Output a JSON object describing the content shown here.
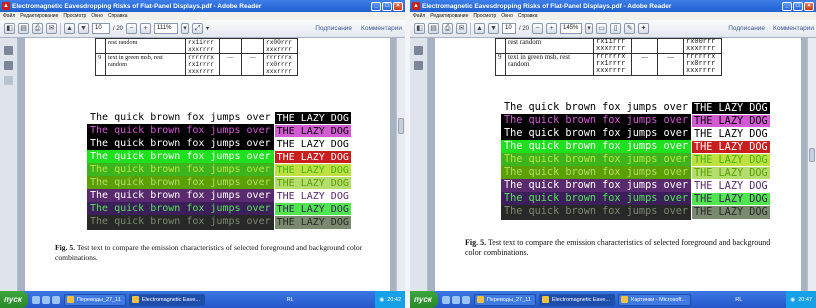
{
  "window": {
    "title": "Electromagnetic Eavesdropping Risks of Flat-Panel Displays.pdf - Adobe Reader",
    "menu": [
      "Файл",
      "Редактирование",
      "Просмотр",
      "Окно",
      "Справка"
    ]
  },
  "toolbar": {
    "page_current": "10",
    "page_total": "/ 20",
    "zoom_left": "111%",
    "zoom_right": "145%",
    "sign_label": "Подписание",
    "comments_label": "Комментарии"
  },
  "table": {
    "row_a": {
      "num": "",
      "desc": "rest random",
      "c1": "rx1irrr",
      "c1b": "xxxrrrr",
      "c2": "",
      "c3": "",
      "c4": "rx00rrr",
      "c4b": "xxxrrrr"
    },
    "row_9": {
      "num": "9",
      "desc": "text in green msb, rest random",
      "c1": "rrrrrrx",
      "c1b": "rx1rrrr",
      "c1c": "xxxrrrr",
      "c2": "—",
      "c3": "—",
      "c4": "rrrrrrx",
      "c4b": "rx0rrrr",
      "c4c": "xxxrrrr"
    }
  },
  "fox_lines": [
    {
      "text": "The quick brown fox jumps over",
      "lazy": "THE LAZY DOG",
      "bg": "#ffffff",
      "fg": "#000000",
      "lazy_bg": "#000000",
      "lazy_fg": "#ffffff"
    },
    {
      "text": "The quick brown fox jumps over",
      "lazy": "THE LAZY DOG",
      "bg": "#000000",
      "fg": "#d25ad2",
      "lazy_bg": "#d25ad2",
      "lazy_fg": "#000000"
    },
    {
      "text": "The quick brown fox jumps over",
      "lazy": "THE LAZY DOG",
      "bg": "#000000",
      "fg": "#ffffff",
      "lazy_bg": "#ffffff",
      "lazy_fg": "#000000"
    },
    {
      "text": "The quick brown fox jumps over",
      "lazy": "THE LAZY DOG",
      "bg": "#1ee01e",
      "fg": "#ffffff",
      "lazy_bg": "#c81e1e",
      "lazy_fg": "#ffffff"
    },
    {
      "text": "The quick brown fox jumps over",
      "lazy": "THE LAZY DOG",
      "bg": "#3cb41e",
      "fg": "#c0e040",
      "lazy_bg": "#c0e040",
      "lazy_fg": "#3cb41e"
    },
    {
      "text": "The quick brown fox jumps over",
      "lazy": "THE LAZY DOG",
      "bg": "#5aa000",
      "fg": "#b4dc6e",
      "lazy_bg": "#b4dc6e",
      "lazy_fg": "#5aa000"
    },
    {
      "text": "The quick brown fox jumps over",
      "lazy": "THE LAZY DOG",
      "bg": "#5a2a6e",
      "fg": "#ffffff",
      "lazy_bg": "#ffffff",
      "lazy_fg": "#5a2a6e"
    },
    {
      "text": "The quick brown fox jumps over",
      "lazy": "THE LAZY DOG",
      "bg": "#3c1e5a",
      "fg": "#50e650",
      "lazy_bg": "#50e650",
      "lazy_fg": "#3c1e5a"
    },
    {
      "text": "The quick brown fox jumps over",
      "lazy": "THE LAZY DOG",
      "bg": "#282828",
      "fg": "#7a8a6e",
      "lazy_bg": "#7a8a6e",
      "lazy_fg": "#282828"
    }
  ],
  "caption": {
    "label": "Fig. 5.",
    "text": "Test text to compare the emission characteristics of selected foreground and background color combinations."
  },
  "taskbar": {
    "start_label": "пуск",
    "tasks_left": [
      "Переводы_27_11",
      "Electromagnetic Eave..."
    ],
    "tasks_right": [
      "Переводы_27_11",
      "Electromagnetic Eave...",
      "Картинки - Microsoft..."
    ],
    "lang": "RL",
    "clock_left": "20:42",
    "clock_right": "20:47"
  }
}
